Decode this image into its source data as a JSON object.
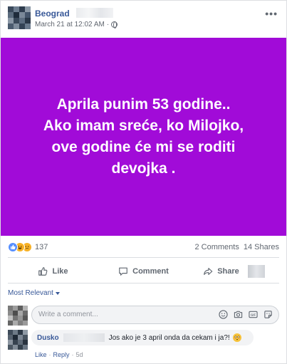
{
  "header": {
    "author": "Beograd",
    "timestamp": "March 21 at 12:02 AM",
    "separator": "·",
    "more_label": "•••"
  },
  "post": {
    "background_color": "#a10bd8",
    "text_color": "#ffffff",
    "text_lines": [
      "Aprila punim 53 godine..",
      "Ako imam sreće, ko Milojko,",
      "ove godine će mi se roditi",
      "devojka ."
    ]
  },
  "stats": {
    "reaction_icons": [
      "like-icon",
      "haha-icon",
      "sad-icon"
    ],
    "reaction_count": "137",
    "comments": "2 Comments",
    "shares": "14 Shares"
  },
  "actions": {
    "like": "Like",
    "comment": "Comment",
    "share": "Share"
  },
  "sort": {
    "label": "Most Relevant"
  },
  "compose": {
    "placeholder": "Write a comment...",
    "icons": [
      "emoji-icon",
      "camera-icon",
      "gif-icon",
      "sticker-icon"
    ]
  },
  "comments": [
    {
      "author": "Dusko",
      "text": "Jos ako je 3 april onda da cekam i ja?!",
      "like_label": "Like",
      "reply_label": "Reply",
      "dot": "·",
      "age": "5d"
    }
  ],
  "colors": {
    "link": "#385898",
    "muted": "#606770",
    "accent": "#a10bd8"
  }
}
